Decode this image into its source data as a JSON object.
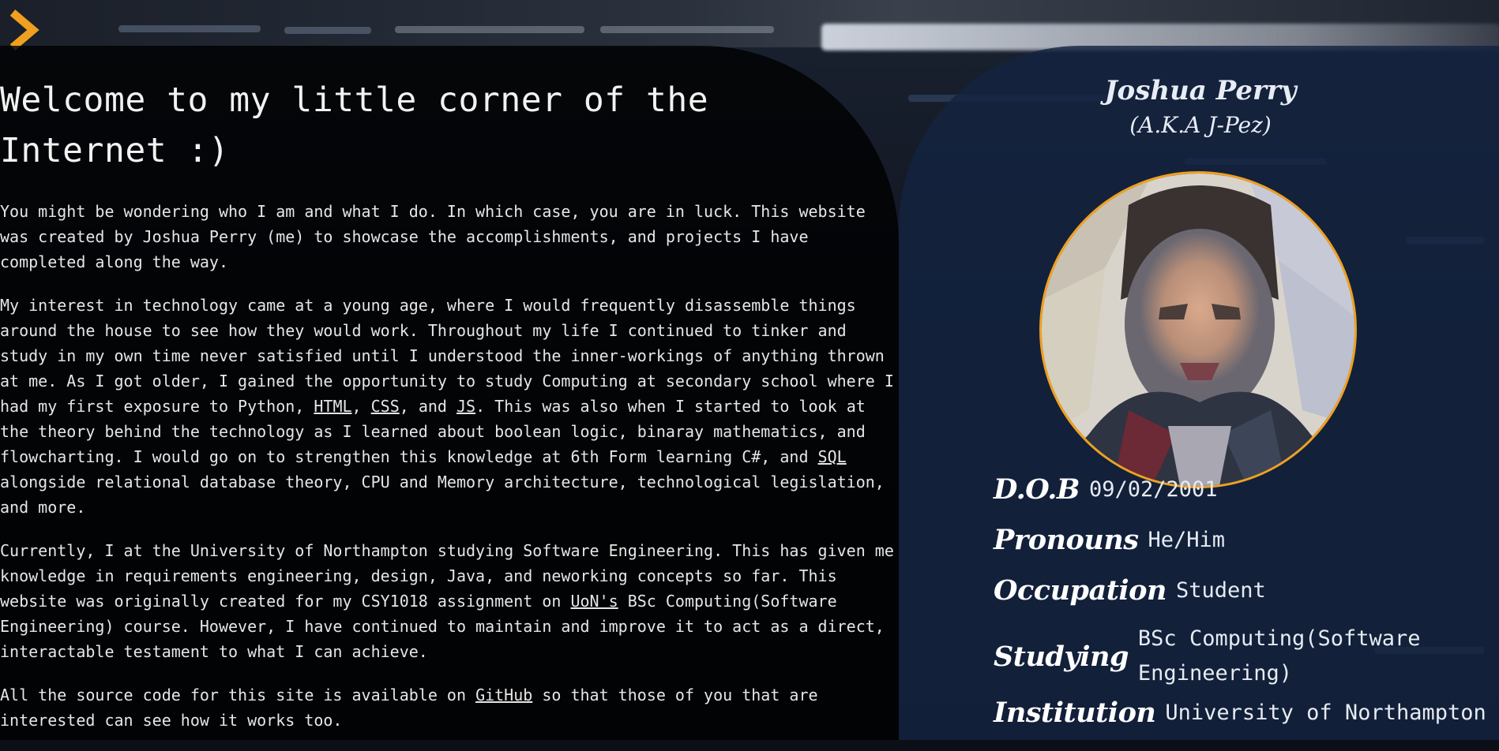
{
  "page": {
    "welcome": "Welcome to my little corner of the Internet :)",
    "paragraphs": {
      "p1": "You might be wondering who I am and what I do. In which case, you are in luck. This website was created by Joshua Perry (me) to showcase the accomplishments, and projects I have completed along the way.",
      "p2_a": "My interest in technology came at a young age, where I would frequently disassemble things around the house to see how they would work. Throughout my life I continued to tinker and study in my own time never satisfied until I understood the inner-workings of anything thrown at me. As I got older, I gained the opportunity to study Computing at secondary school where I had my first exposure to Python, ",
      "link_html": "HTML",
      "p2_b": ", ",
      "link_css": "CSS",
      "p2_c": ", and ",
      "link_js": "JS",
      "p2_d": ". This was also when I started to look at the theory behind the technology as I learned about boolean logic, binaray mathematics, and flowcharting. I would go on to strengthen this knowledge at 6th Form learning C#, and ",
      "link_sql": "SQL",
      "p2_e": " alongside relational database theory, CPU and Memory architecture, technological legislation, and more.",
      "p3_a": "Currently, I at the University of Northampton studying Software Engineering. This has given me knowledge in requirements engineering, design, Java, and neworking concepts so far. This website was originally created for my CSY1018 assignment on ",
      "link_uon": "UoN's",
      "p3_b": " BSc Computing(Software Engineering) course. However, I have continued to maintain and improve it to act as a direct, interactable testament to what I can achieve.",
      "p4_a": "All the source code for this site is available on ",
      "link_github": "GitHub",
      "p4_b": " so that those of you that are interested can see how it works too."
    }
  },
  "profile": {
    "name": "Joshua Perry",
    "aka": "(A.K.A J-Pez)",
    "details": {
      "dob_label": "D.O.B",
      "dob_value": "09/02/2001",
      "pronouns_label": "Pronouns",
      "pronouns_value": "He/Him",
      "occupation_label": "Occupation",
      "occupation_value": "Student",
      "studying_label": "Studying",
      "studying_value": "BSc Computing(Software Engineering)",
      "institution_label": "Institution",
      "institution_value": "University of Northampton"
    }
  },
  "icons": {
    "menu": "chevron-right-icon",
    "avatar": "profile-photo"
  },
  "colors": {
    "accent": "#f0a020",
    "left_panel": "#000000",
    "right_panel": "#14233f",
    "text": "#e6e6e6"
  }
}
